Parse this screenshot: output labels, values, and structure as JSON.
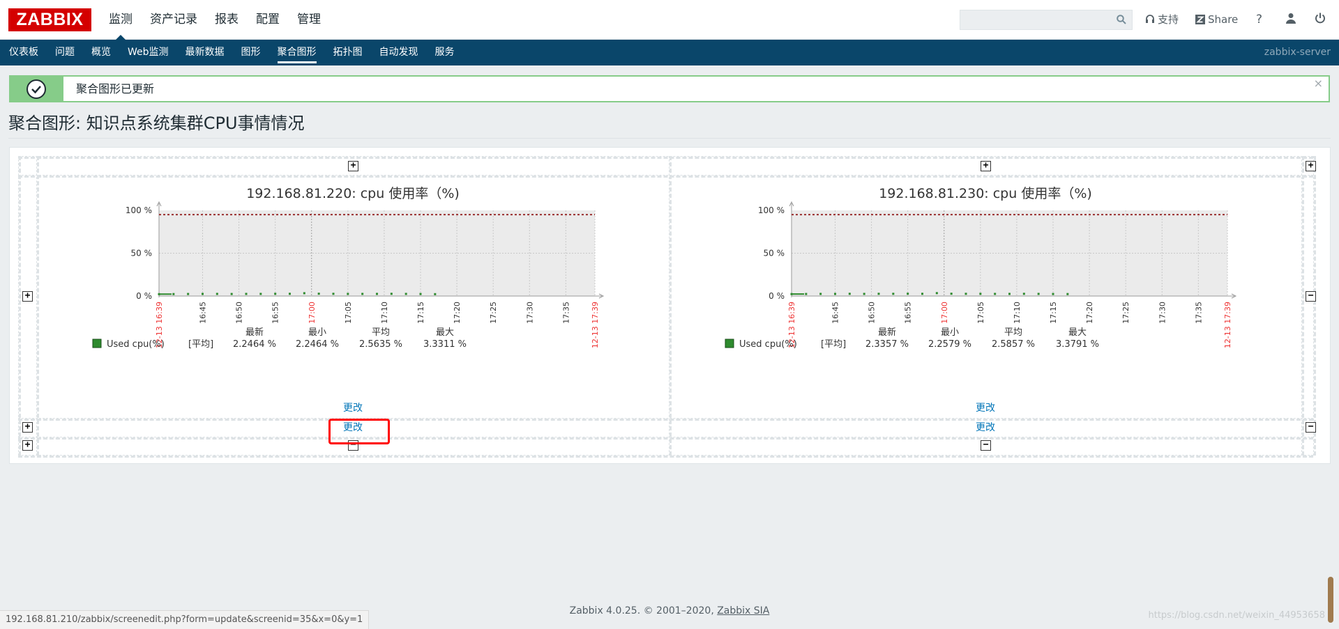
{
  "header": {
    "logo": "ZABBIX",
    "main_menu": [
      "监测",
      "资产记录",
      "报表",
      "配置",
      "管理"
    ],
    "search_placeholder": "",
    "support": "支持",
    "share": "Share",
    "help": "?"
  },
  "nav": {
    "items": [
      "仪表板",
      "问题",
      "概览",
      "Web监测",
      "最新数据",
      "图形",
      "聚合图形",
      "拓扑图",
      "自动发现",
      "服务"
    ],
    "active": "聚合图形",
    "server": "zabbix-server"
  },
  "message": {
    "text": "聚合图形已更新",
    "close": "×"
  },
  "page_title": "聚合图形: 知识点系统集群CPU事情情况",
  "graphs": [
    {
      "title": "192.168.81.220: cpu 使用率（%)",
      "legend": {
        "name": "Used cpu(%)",
        "func": "[平均]",
        "headers": [
          "最新",
          "最小",
          "平均",
          "最大"
        ],
        "values": [
          "2.2464 %",
          "2.2464 %",
          "2.5635 %",
          "3.3311 %"
        ]
      }
    },
    {
      "title": "192.168.81.230: cpu 使用率（%)",
      "legend": {
        "name": "Used cpu(%)",
        "func": "[平均]",
        "headers": [
          "最新",
          "最小",
          "平均",
          "最大"
        ],
        "values": [
          "2.3357 %",
          "2.2579 %",
          "2.5857 %",
          "3.3791 %"
        ]
      }
    }
  ],
  "chart_data": [
    {
      "type": "line",
      "title": "192.168.81.220: cpu 使用率（%)",
      "ylabels": [
        "100 %",
        "50 %",
        "0 %"
      ],
      "ylim": [
        0,
        100
      ],
      "xlabels": [
        "12-13 16:39",
        "16:45",
        "16:50",
        "16:55",
        "17:00",
        "17:05",
        "17:10",
        "17:15",
        "17:20",
        "17:25",
        "17:30",
        "17:35",
        "12-13 17:39"
      ],
      "series": [
        {
          "name": "Used cpu(%)",
          "color": "#2d8a2d",
          "x": [
            "16:39",
            "16:41",
            "16:43",
            "16:45",
            "16:47",
            "16:49",
            "16:51",
            "16:53",
            "16:55",
            "16:57",
            "16:59",
            "17:01",
            "17:03",
            "17:05",
            "17:07",
            "17:09",
            "17:11",
            "17:13",
            "17:15",
            "17:17"
          ],
          "values": [
            2.2,
            2.3,
            2.4,
            2.5,
            2.5,
            2.4,
            2.5,
            2.5,
            2.6,
            2.6,
            3.3,
            2.7,
            2.6,
            2.5,
            2.5,
            2.5,
            2.6,
            2.5,
            2.4,
            2.2
          ]
        }
      ],
      "trigger_line": 95,
      "trigger_color": "#9b2f2f",
      "red_xlabels": [
        "12-13 16:39",
        "17:00",
        "12-13 17:39"
      ]
    },
    {
      "type": "line",
      "title": "192.168.81.230: cpu 使用率（%)",
      "ylabels": [
        "100 %",
        "50 %",
        "0 %"
      ],
      "ylim": [
        0,
        100
      ],
      "xlabels": [
        "12-13 16:39",
        "16:45",
        "16:50",
        "16:55",
        "17:00",
        "17:05",
        "17:10",
        "17:15",
        "17:20",
        "17:25",
        "17:30",
        "17:35",
        "12-13 17:39"
      ],
      "series": [
        {
          "name": "Used cpu(%)",
          "color": "#2d8a2d",
          "x": [
            "16:39",
            "16:41",
            "16:43",
            "16:45",
            "16:47",
            "16:49",
            "16:51",
            "16:53",
            "16:55",
            "16:57",
            "16:59",
            "17:01",
            "17:03",
            "17:05",
            "17:07",
            "17:09",
            "17:11",
            "17:13",
            "17:15",
            "17:17"
          ],
          "values": [
            2.3,
            2.4,
            2.5,
            2.5,
            2.6,
            2.5,
            2.6,
            2.6,
            2.7,
            2.6,
            3.4,
            2.7,
            2.6,
            2.6,
            2.5,
            2.5,
            2.6,
            2.5,
            2.4,
            2.3
          ]
        }
      ],
      "trigger_line": 95,
      "trigger_color": "#9b2f2f",
      "red_xlabels": [
        "12-13 16:39",
        "17:00",
        "12-13 17:39"
      ]
    }
  ],
  "change_label": "更改",
  "footer": {
    "text": "Zabbix 4.0.25. © 2001–2020, ",
    "link": "Zabbix SIA"
  },
  "status_url": "192.168.81.210/zabbix/screenedit.php?form=update&screenid=35&x=0&y=1",
  "watermark": "https://blog.csdn.net/weixin_44953658"
}
